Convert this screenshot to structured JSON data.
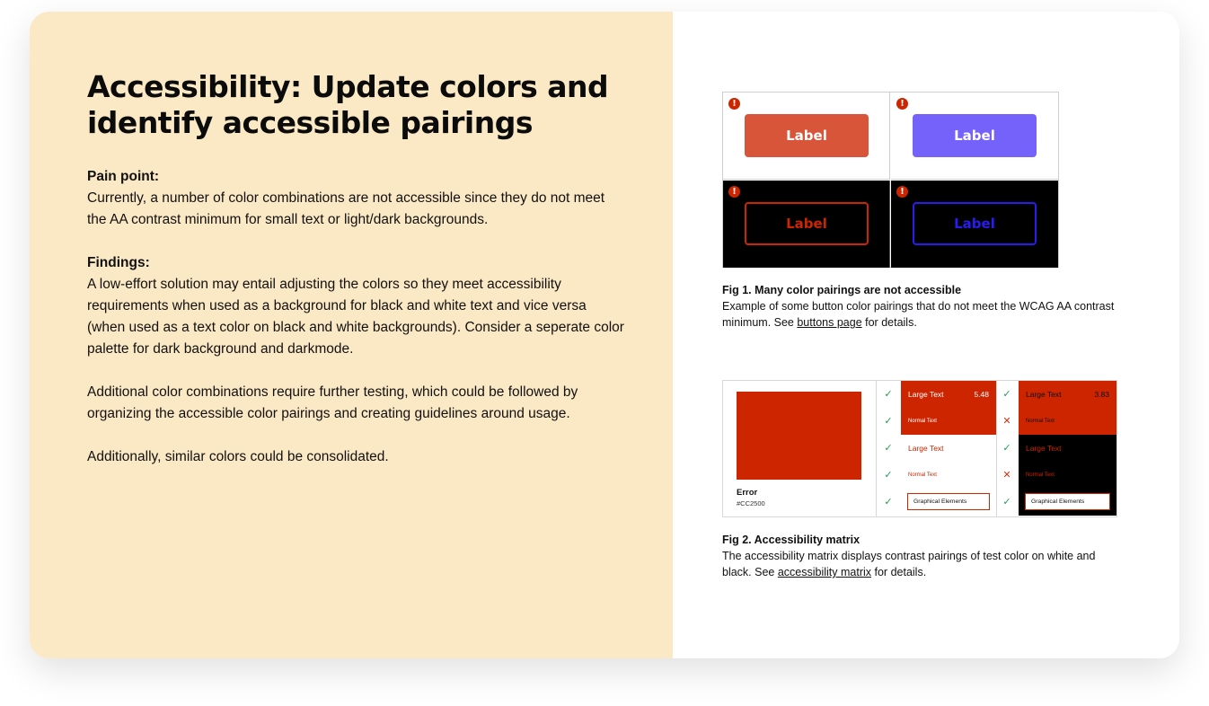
{
  "heading": "Accessibility: Update colors and identify accessible pairings",
  "pain_point": {
    "label": "Pain point:",
    "text": "Currently, a number of color combinations are not accessible since they do not meet the AA contrast minimum for small text or light/dark backgrounds."
  },
  "findings": {
    "label": "Findings:",
    "text": "A low-effort solution may entail adjusting the colors so they meet accessibility requirements when used as a background for black and white text and vice versa (when used as a text color on black and white backgrounds).  Consider a seperate color palette for dark background and darkmode."
  },
  "paragraph_additional": "Additional color combinations require further testing, which could be followed by organizing the accessible color pairings and creating guidelines around usage.",
  "paragraph_consolidate": "Additionally, similar colors could be consolidated.",
  "fig1": {
    "warning_icon": "exclamation-circle-icon",
    "buttons": [
      {
        "label": "Label",
        "style": "solid",
        "color": "#D9553A"
      },
      {
        "label": "Label",
        "style": "solid",
        "color": "#7462FB"
      },
      {
        "label": "Label",
        "style": "outline",
        "color": "#CC2500"
      },
      {
        "label": "Label",
        "style": "outline",
        "color": "#2A1CF0"
      }
    ],
    "caption_title": "Fig 1. Many color pairings are not accessible",
    "caption_before_link": "Example of some button color pairings that do not meet the WCAG AA contrast minimum. See ",
    "caption_link": "buttons page",
    "caption_after_link": " for details."
  },
  "fig2": {
    "swatch": {
      "name": "Error",
      "hex": "#CC2500"
    },
    "white_column": [
      {
        "text": "Large Text",
        "ratio": "5.48",
        "pass": true
      },
      {
        "text": "Normal Text",
        "pass": true
      },
      {
        "text": "Large Text",
        "pass": true
      },
      {
        "text": "Normal Text",
        "pass": true
      },
      {
        "text": "Graphical Elements",
        "pass": true
      }
    ],
    "black_column": [
      {
        "text": "Large Text",
        "ratio": "3.83",
        "pass": true
      },
      {
        "text": "Normal Text",
        "pass": false
      },
      {
        "text": "Large Text",
        "pass": true
      },
      {
        "text": "Normal Text",
        "pass": false
      },
      {
        "text": "Graphical Elements",
        "pass": true
      }
    ],
    "caption_title": "Fig 2. Accessibility matrix",
    "caption_before_link": "The accessibility matrix displays contrast pairings of test color on white and black. See ",
    "caption_link": "accessibility matrix",
    "caption_after_link": " for details."
  },
  "colors": {
    "left_panel_bg": "#FBE8C4",
    "test_color": "#CC2500",
    "pass_check": "#1F9D55",
    "fail_cross": "#D12D12"
  }
}
